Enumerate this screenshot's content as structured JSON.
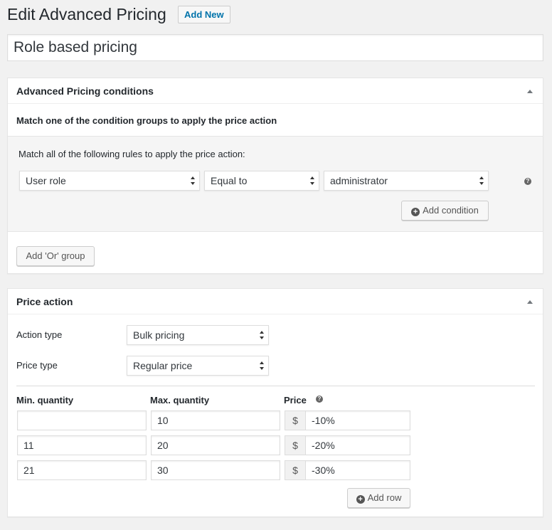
{
  "page": {
    "title": "Edit Advanced Pricing",
    "add_new_label": "Add New",
    "post_title": "Role based pricing"
  },
  "conditions_box": {
    "title": "Advanced Pricing conditions",
    "match_text": "Match one of the condition groups to apply the price action",
    "group": {
      "rules_text": "Match all of the following rules to apply the price action:",
      "condition": {
        "field": "User role",
        "operator": "Equal to",
        "value": "administrator"
      },
      "add_condition_label": "Add condition"
    },
    "add_or_group_label": "Add 'Or' group"
  },
  "price_action_box": {
    "title": "Price action",
    "action_type_label": "Action type",
    "action_type_value": "Bulk pricing",
    "price_type_label": "Price type",
    "price_type_value": "Regular price",
    "columns": {
      "min": "Min. quantity",
      "max": "Max. quantity",
      "price": "Price"
    },
    "currency_symbol": "$",
    "rows": [
      {
        "min": "",
        "max": "10",
        "price": "-10%"
      },
      {
        "min": "11",
        "max": "20",
        "price": "-20%"
      },
      {
        "min": "21",
        "max": "30",
        "price": "-30%"
      }
    ],
    "add_row_label": "Add row"
  },
  "icons": {
    "help": "?",
    "plus": "+"
  }
}
